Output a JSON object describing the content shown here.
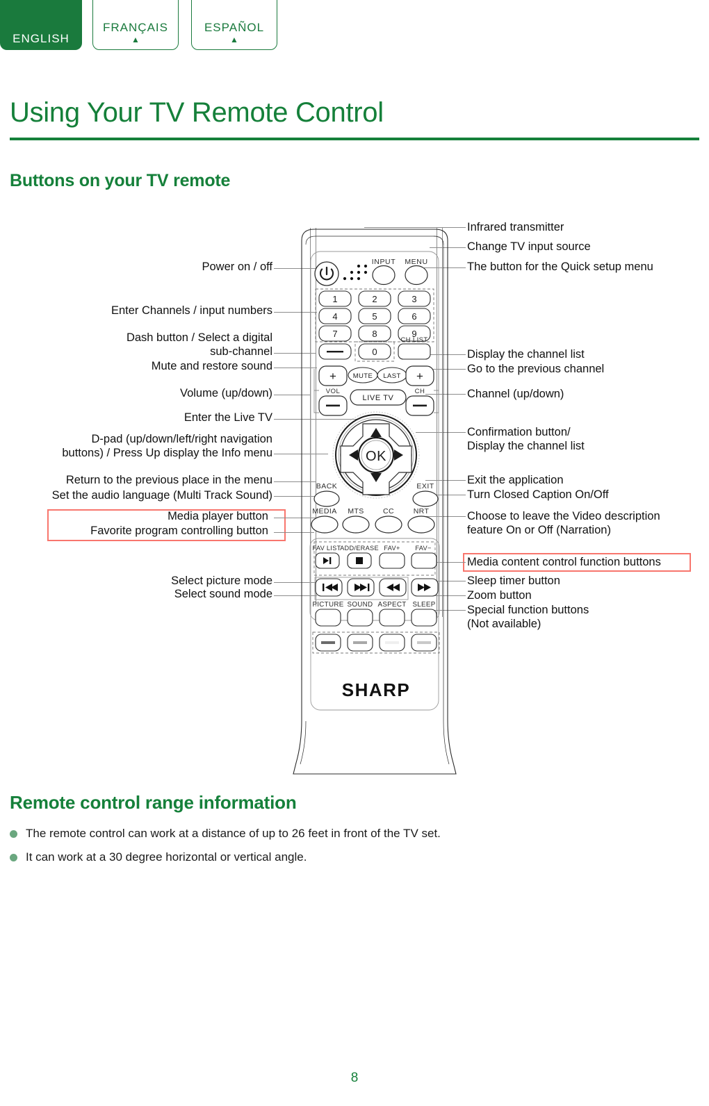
{
  "colors": {
    "brand_green": "#15803a",
    "tab_green": "#1a7a3d",
    "highlight_red": "#f8766d",
    "bullet_green": "#6aa77f",
    "leader_gray": "#8c8c8c"
  },
  "language_tabs": [
    {
      "label": "ENGLISH",
      "arrow": "",
      "active": true
    },
    {
      "label": "FRANÇAIS",
      "arrow": "▲",
      "active": false
    },
    {
      "label": "ESPAÑOL",
      "arrow": "▲",
      "active": false
    }
  ],
  "page_title": "Using Your TV Remote Control",
  "section_1": {
    "heading": "Buttons on your TV remote"
  },
  "section_2": {
    "heading": "Remote control range information",
    "bullets": [
      "The remote control can work at a distance of up to 26 feet in front of the TV set.",
      "It can work at a 30 degree horizontal or vertical angle."
    ]
  },
  "callouts_left": [
    {
      "text": "Power on / off"
    },
    {
      "text": "Enter Channels / input numbers"
    },
    {
      "text": "Dash button / Select a digital\nsub-channel"
    },
    {
      "text": "Mute and restore sound"
    },
    {
      "text": "Volume (up/down)"
    },
    {
      "text": "Enter the Live TV"
    },
    {
      "text": "D-pad (up/down/left/right navigation\nbuttons) / Press Up display the Info menu"
    },
    {
      "text": "Return to the previous place in the menu"
    },
    {
      "text": "Set the audio language (Multi Track Sound)"
    },
    {
      "text": "Media player button",
      "highlighted": true
    },
    {
      "text": "Favorite program controlling button",
      "highlighted": true
    },
    {
      "text": "Select picture mode"
    },
    {
      "text": "Select sound mode"
    }
  ],
  "callouts_right": [
    {
      "text": "Infrared transmitter"
    },
    {
      "text": "Change TV input source"
    },
    {
      "text": "The button for the Quick setup menu"
    },
    {
      "text": "Display the channel list"
    },
    {
      "text": "Go to the previous channel"
    },
    {
      "text": "Channel (up/down)"
    },
    {
      "text": "Confirmation button/\nDisplay the channel list"
    },
    {
      "text": "Exit the application"
    },
    {
      "text": "Turn Closed Caption On/Off"
    },
    {
      "text": "Choose to leave the Video description\nfeature On or Off (Narration)"
    },
    {
      "text": "Media content control function buttons",
      "highlighted": true
    },
    {
      "text": "Sleep timer button"
    },
    {
      "text": "Zoom button"
    },
    {
      "text": "Special function buttons\n(Not available)"
    }
  ],
  "remote": {
    "brand": "SHARP",
    "top_buttons": [
      {
        "name": "power-button",
        "label": "⏻"
      },
      {
        "name": "ir-dots",
        "label": ""
      },
      {
        "name": "input-button",
        "label": "INPUT"
      },
      {
        "name": "menu-button",
        "label": "MENU"
      }
    ],
    "keypad": [
      "1",
      "2",
      "3",
      "4",
      "5",
      "6",
      "7",
      "8",
      "9"
    ],
    "keypad_row4": [
      {
        "name": "dash-button",
        "label": "—"
      },
      {
        "name": "zero-button",
        "label": "0"
      },
      {
        "name": "chlist-button",
        "label": "CH LIST"
      }
    ],
    "mid_buttons": [
      {
        "name": "vol-up-button",
        "label": "+"
      },
      {
        "name": "mute-button",
        "label": "MUTE"
      },
      {
        "name": "last-button",
        "label": "LAST"
      },
      {
        "name": "ch-up-button",
        "label": "+"
      },
      {
        "name": "vol-label",
        "label": "VOL"
      },
      {
        "name": "ch-label",
        "label": "CH"
      },
      {
        "name": "vol-down-button",
        "label": "—"
      },
      {
        "name": "livetv-button",
        "label": "LIVE TV"
      },
      {
        "name": "ch-down-button",
        "label": "—"
      }
    ],
    "dpad": {
      "ok": "OK",
      "up": "▲",
      "down": "▼",
      "left": "◀",
      "right": "▶"
    },
    "back_exit": [
      {
        "name": "back-button",
        "label": "BACK"
      },
      {
        "name": "exit-button",
        "label": "EXIT"
      }
    ],
    "function_row": [
      {
        "name": "media-button",
        "label": "MEDIA"
      },
      {
        "name": "mts-button",
        "label": "MTS"
      },
      {
        "name": "cc-button",
        "label": "CC"
      },
      {
        "name": "nrt-button",
        "label": "NRT"
      }
    ],
    "fav_row": [
      {
        "name": "fav-list-button",
        "label": "FAV LIST",
        "glyph": "▶❙"
      },
      {
        "name": "add-erase-button",
        "label": "ADD/ERASE",
        "glyph": "■"
      },
      {
        "name": "fav-plus-button",
        "label": "FAV+",
        "glyph": ""
      },
      {
        "name": "fav-minus-button",
        "label": "FAV−",
        "glyph": ""
      }
    ],
    "transport_row": [
      {
        "name": "prev-track-button",
        "glyph": "⏮"
      },
      {
        "name": "next-track-button",
        "glyph": "⏭"
      },
      {
        "name": "rewind-button",
        "glyph": "◀◀"
      },
      {
        "name": "fastforward-button",
        "glyph": "▶▶"
      }
    ],
    "mode_row": [
      {
        "name": "picture-button",
        "label": "PICTURE"
      },
      {
        "name": "sound-button",
        "label": "SOUND"
      },
      {
        "name": "aspect-button",
        "label": "ASPECT"
      },
      {
        "name": "sleep-button",
        "label": "SLEEP"
      }
    ],
    "special_row": [
      {
        "name": "special-button-1",
        "color": "#6b6b6b"
      },
      {
        "name": "special-button-2",
        "color": "#a8a8a8"
      },
      {
        "name": "special-button-3",
        "color": "#efefef"
      },
      {
        "name": "special-button-4",
        "color": "#c9c9c9"
      }
    ]
  },
  "page_number": "8"
}
